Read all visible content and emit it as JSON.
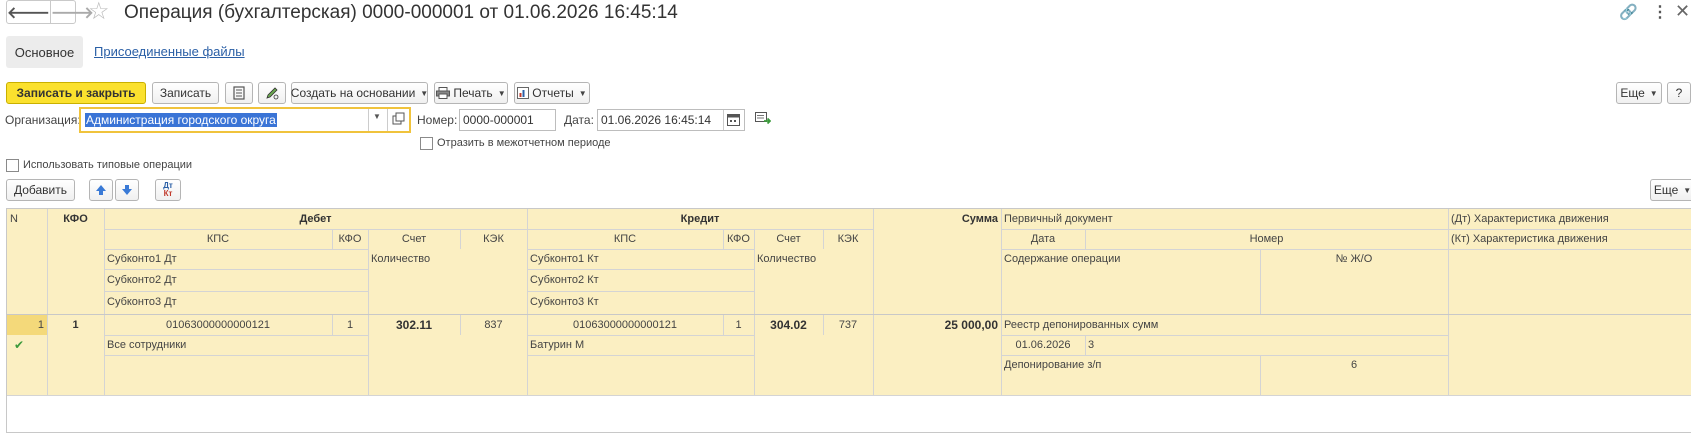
{
  "window": {
    "title": "Операция (бухгалтерская) 0000-000001 от 01.06.2026 16:45:14",
    "back_glyph": "🡐",
    "forward_glyph": "🡒",
    "star_glyph": "☆",
    "link_glyph": "🔗",
    "kebab_glyph": "⋮",
    "close_glyph": "✕"
  },
  "tabs": {
    "main": "Основное",
    "files": "Присоединенные файлы"
  },
  "toolbar": {
    "save_close": "Записать и закрыть",
    "save": "Записать",
    "create_based": "Создать на основании",
    "print": "Печать",
    "reports": "Отчеты",
    "more": "Еще",
    "help": "?"
  },
  "form": {
    "org_label": "Организация:",
    "org_value": "Администрация городского округа",
    "number_label": "Номер:",
    "number_value": "0000-000001",
    "date_label": "Дата:",
    "date_value": "01.06.2026 16:45:14",
    "interaccount_label": "Отразить в межотчетном периоде",
    "typical_ops_label": "Использовать типовые операции"
  },
  "table_toolbar": {
    "add": "Добавить",
    "more": "Еще",
    "dtkt_top": "Дт",
    "dtkt_bottom": "Кт"
  },
  "grid": {
    "headers": {
      "n": "N",
      "kfo": "КФО",
      "debit": "Дебет",
      "credit": "Кредит",
      "kps": "КПС",
      "kfo_sub": "КФО",
      "account": "Счет",
      "kek": "КЭК",
      "qty": "Количество",
      "sub1_dt": "Субконто1 Дт",
      "sub2_dt": "Субконто2 Дт",
      "sub3_dt": "Субконто3 Дт",
      "sub1_kt": "Субконто1 Кт",
      "sub2_kt": "Субконто2 Кт",
      "sub3_kt": "Субконто3 Кт",
      "sum": "Сумма",
      "primary_doc": "Первичный документ",
      "date": "Дата",
      "number": "Номер",
      "content": "Содержание операции",
      "journal": "№ Ж/О",
      "dt_char": "(Дт) Характеристика движения",
      "kt_char": "(Кт) Характеристика движения"
    },
    "rows": [
      {
        "n": "1",
        "kfo": "1",
        "dt_kps": "01063000000000121",
        "dt_kfo": "1",
        "dt_account": "302.11",
        "dt_kek": "837",
        "dt_sub1": "Все сотрудники",
        "kt_kps": "01063000000000121",
        "kt_kfo": "1",
        "kt_account": "304.02",
        "kt_kek": "737",
        "kt_sub1": "Батурин М",
        "sum": "25 000,00",
        "doc_name": "Реестр депонированных сумм",
        "doc_date": "01.06.2026",
        "doc_number": "3",
        "content": "Депонирование з/п",
        "journal": "6",
        "status_glyph": "✔"
      }
    ]
  }
}
